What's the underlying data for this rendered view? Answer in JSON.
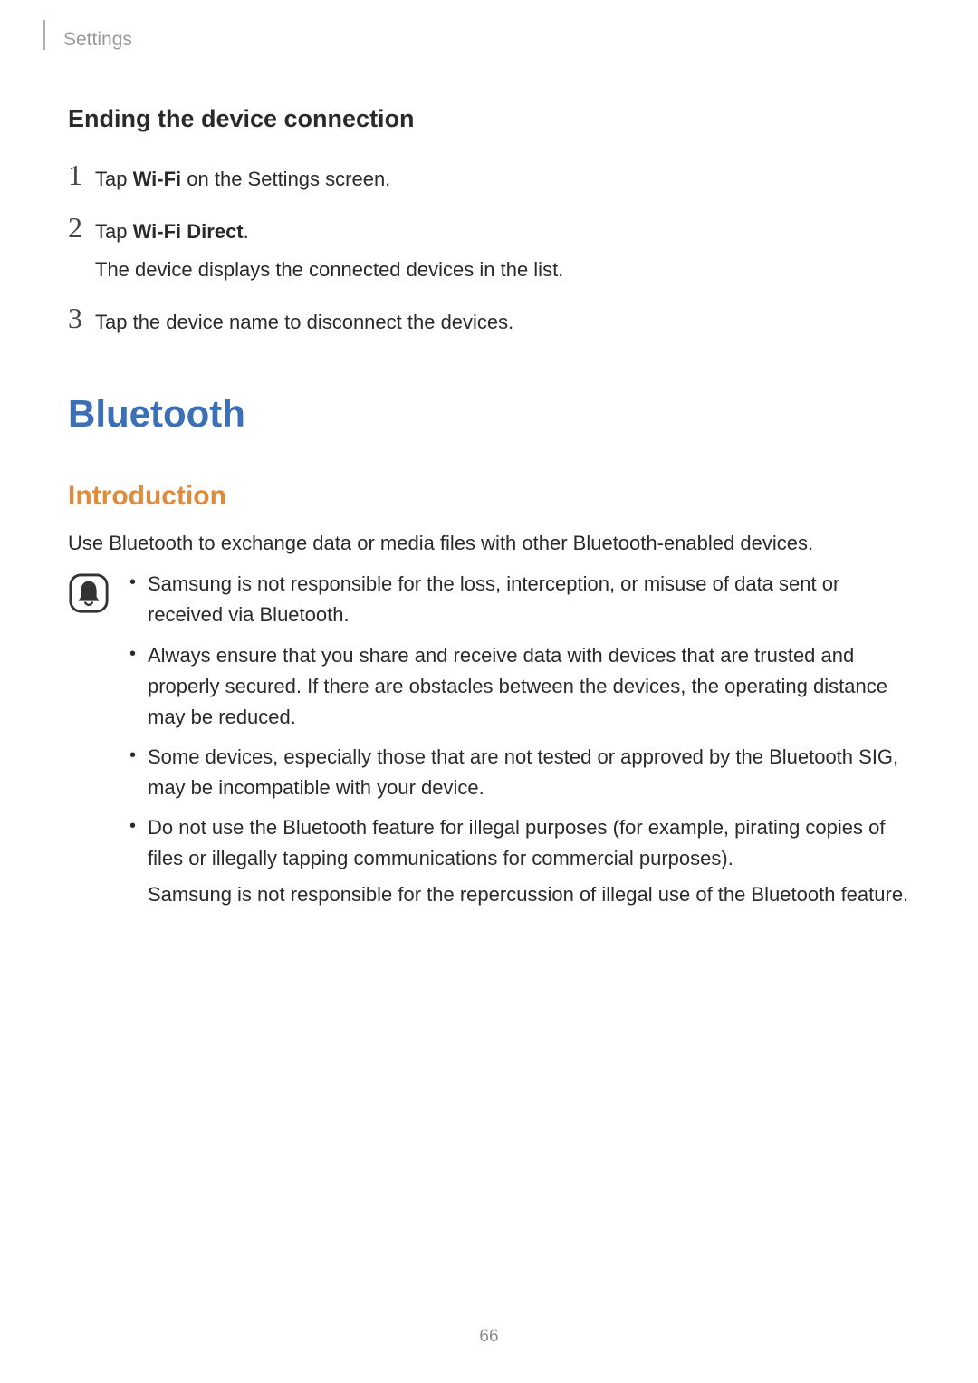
{
  "header": {
    "breadcrumb": "Settings"
  },
  "section1": {
    "heading": "Ending the device connection",
    "steps": [
      {
        "num": "1",
        "prefix": "Tap ",
        "bold": "Wi-Fi",
        "suffix": " on the Settings screen.",
        "sub": ""
      },
      {
        "num": "2",
        "prefix": "Tap ",
        "bold": "Wi-Fi Direct",
        "suffix": ".",
        "sub": "The device displays the connected devices in the list."
      },
      {
        "num": "3",
        "prefix": "Tap the device name to disconnect the devices.",
        "bold": "",
        "suffix": "",
        "sub": ""
      }
    ]
  },
  "section2": {
    "title": "Bluetooth",
    "subheading": "Introduction",
    "intro": "Use Bluetooth to exchange data or media files with other Bluetooth-enabled devices.",
    "notices": [
      {
        "text": "Samsung is not responsible for the loss, interception, or misuse of data sent or received via Bluetooth.",
        "extra": ""
      },
      {
        "text": "Always ensure that you share and receive data with devices that are trusted and properly secured. If there are obstacles between the devices, the operating distance may be reduced.",
        "extra": ""
      },
      {
        "text": "Some devices, especially those that are not tested or approved by the Bluetooth SIG, may be incompatible with your device.",
        "extra": ""
      },
      {
        "text": "Do not use the Bluetooth feature for illegal purposes (for example, pirating copies of files or illegally tapping communications for commercial purposes).",
        "extra": "Samsung is not responsible for the repercussion of illegal use of the Bluetooth feature."
      }
    ]
  },
  "page_number": "66"
}
